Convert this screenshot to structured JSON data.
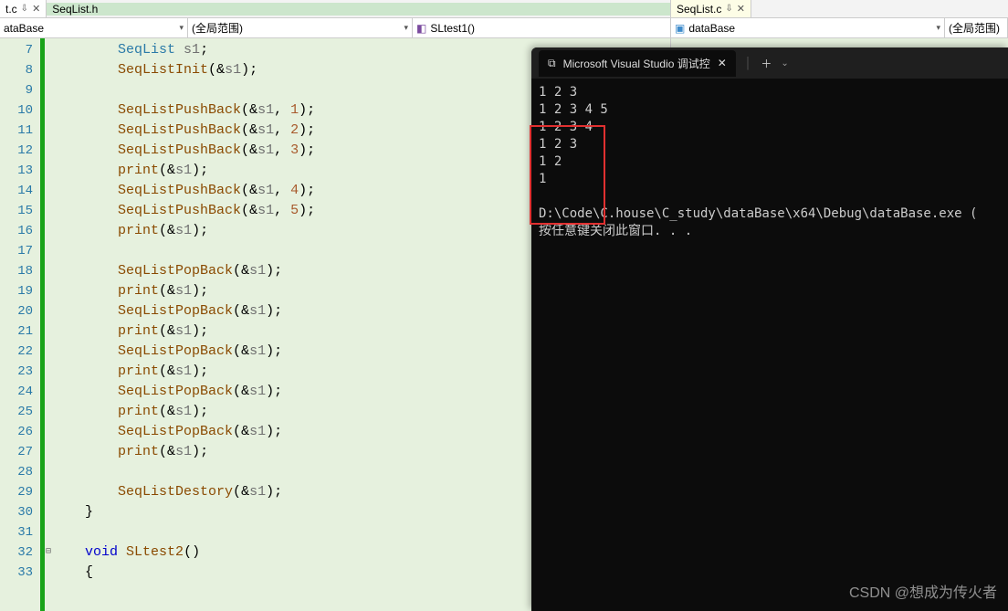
{
  "tabs": {
    "left": {
      "label": "t.c",
      "pin": "⇩",
      "close": "✕"
    },
    "center": {
      "label": "SeqList.h"
    },
    "right_group": {
      "nav_down": "▾",
      "add": "✚"
    },
    "right_pane_tab": {
      "label": "SeqList.c",
      "pin": "⇩",
      "close": "✕"
    }
  },
  "scope": {
    "left1": "ataBase",
    "left2": "(全局范围)",
    "func": "SLtest1()",
    "split": "↔",
    "right1": "dataBase",
    "right2": "(全局范围)"
  },
  "lines": [
    {
      "n": "7",
      "indent": "        ",
      "parts": [
        [
          "type",
          "SeqList"
        ],
        [
          "plain",
          " "
        ],
        [
          "var",
          "s1"
        ],
        [
          "punc",
          ";"
        ]
      ]
    },
    {
      "n": "8",
      "indent": "        ",
      "parts": [
        [
          "func",
          "SeqListInit"
        ],
        [
          "punc",
          "("
        ],
        [
          "op",
          "&"
        ],
        [
          "var",
          "s1"
        ],
        [
          "punc",
          ")"
        ],
        [
          "punc",
          ";"
        ]
      ]
    },
    {
      "n": "9",
      "indent": "",
      "parts": []
    },
    {
      "n": "10",
      "indent": "        ",
      "parts": [
        [
          "func",
          "SeqListPushBack"
        ],
        [
          "punc",
          "("
        ],
        [
          "op",
          "&"
        ],
        [
          "var",
          "s1"
        ],
        [
          "punc",
          ", "
        ],
        [
          "num",
          "1"
        ],
        [
          "punc",
          ")"
        ],
        [
          "punc",
          ";"
        ]
      ]
    },
    {
      "n": "11",
      "indent": "        ",
      "parts": [
        [
          "func",
          "SeqListPushBack"
        ],
        [
          "punc",
          "("
        ],
        [
          "op",
          "&"
        ],
        [
          "var",
          "s1"
        ],
        [
          "punc",
          ", "
        ],
        [
          "num",
          "2"
        ],
        [
          "punc",
          ")"
        ],
        [
          "punc",
          ";"
        ]
      ]
    },
    {
      "n": "12",
      "indent": "        ",
      "parts": [
        [
          "func",
          "SeqListPushBack"
        ],
        [
          "punc",
          "("
        ],
        [
          "op",
          "&"
        ],
        [
          "var",
          "s1"
        ],
        [
          "punc",
          ", "
        ],
        [
          "num",
          "3"
        ],
        [
          "punc",
          ")"
        ],
        [
          "punc",
          ";"
        ]
      ]
    },
    {
      "n": "13",
      "indent": "        ",
      "parts": [
        [
          "func",
          "print"
        ],
        [
          "punc",
          "("
        ],
        [
          "op",
          "&"
        ],
        [
          "var",
          "s1"
        ],
        [
          "punc",
          ")"
        ],
        [
          "punc",
          ";"
        ]
      ]
    },
    {
      "n": "14",
      "indent": "        ",
      "parts": [
        [
          "func",
          "SeqListPushBack"
        ],
        [
          "punc",
          "("
        ],
        [
          "op",
          "&"
        ],
        [
          "var",
          "s1"
        ],
        [
          "punc",
          ", "
        ],
        [
          "num",
          "4"
        ],
        [
          "punc",
          ")"
        ],
        [
          "punc",
          ";"
        ]
      ]
    },
    {
      "n": "15",
      "indent": "        ",
      "parts": [
        [
          "func",
          "SeqListPushBack"
        ],
        [
          "punc",
          "("
        ],
        [
          "op",
          "&"
        ],
        [
          "var",
          "s1"
        ],
        [
          "punc",
          ", "
        ],
        [
          "num",
          "5"
        ],
        [
          "punc",
          ")"
        ],
        [
          "punc",
          ";"
        ]
      ]
    },
    {
      "n": "16",
      "indent": "        ",
      "parts": [
        [
          "func",
          "print"
        ],
        [
          "punc",
          "("
        ],
        [
          "op",
          "&"
        ],
        [
          "var",
          "s1"
        ],
        [
          "punc",
          ")"
        ],
        [
          "punc",
          ";"
        ]
      ]
    },
    {
      "n": "17",
      "indent": "",
      "parts": []
    },
    {
      "n": "18",
      "indent": "        ",
      "parts": [
        [
          "func",
          "SeqListPopBack"
        ],
        [
          "punc",
          "("
        ],
        [
          "op",
          "&"
        ],
        [
          "var",
          "s1"
        ],
        [
          "punc",
          ")"
        ],
        [
          "punc",
          ";"
        ]
      ]
    },
    {
      "n": "19",
      "indent": "        ",
      "parts": [
        [
          "func",
          "print"
        ],
        [
          "punc",
          "("
        ],
        [
          "op",
          "&"
        ],
        [
          "var",
          "s1"
        ],
        [
          "punc",
          ")"
        ],
        [
          "punc",
          ";"
        ]
      ]
    },
    {
      "n": "20",
      "indent": "        ",
      "parts": [
        [
          "func",
          "SeqListPopBack"
        ],
        [
          "punc",
          "("
        ],
        [
          "op",
          "&"
        ],
        [
          "var",
          "s1"
        ],
        [
          "punc",
          ")"
        ],
        [
          "punc",
          ";"
        ]
      ]
    },
    {
      "n": "21",
      "indent": "        ",
      "parts": [
        [
          "func",
          "print"
        ],
        [
          "punc",
          "("
        ],
        [
          "op",
          "&"
        ],
        [
          "var",
          "s1"
        ],
        [
          "punc",
          ")"
        ],
        [
          "punc",
          ";"
        ]
      ]
    },
    {
      "n": "22",
      "indent": "        ",
      "parts": [
        [
          "func",
          "SeqListPopBack"
        ],
        [
          "punc",
          "("
        ],
        [
          "op",
          "&"
        ],
        [
          "var",
          "s1"
        ],
        [
          "punc",
          ")"
        ],
        [
          "punc",
          ";"
        ]
      ]
    },
    {
      "n": "23",
      "indent": "        ",
      "parts": [
        [
          "func",
          "print"
        ],
        [
          "punc",
          "("
        ],
        [
          "op",
          "&"
        ],
        [
          "var",
          "s1"
        ],
        [
          "punc",
          ")"
        ],
        [
          "punc",
          ";"
        ]
      ]
    },
    {
      "n": "24",
      "indent": "        ",
      "parts": [
        [
          "func",
          "SeqListPopBack"
        ],
        [
          "punc",
          "("
        ],
        [
          "op",
          "&"
        ],
        [
          "var",
          "s1"
        ],
        [
          "punc",
          ")"
        ],
        [
          "punc",
          ";"
        ]
      ]
    },
    {
      "n": "25",
      "indent": "        ",
      "parts": [
        [
          "func",
          "print"
        ],
        [
          "punc",
          "("
        ],
        [
          "op",
          "&"
        ],
        [
          "var",
          "s1"
        ],
        [
          "punc",
          ")"
        ],
        [
          "punc",
          ";"
        ]
      ]
    },
    {
      "n": "26",
      "indent": "        ",
      "parts": [
        [
          "func",
          "SeqListPopBack"
        ],
        [
          "punc",
          "("
        ],
        [
          "op",
          "&"
        ],
        [
          "var",
          "s1"
        ],
        [
          "punc",
          ")"
        ],
        [
          "punc",
          ";"
        ]
      ]
    },
    {
      "n": "27",
      "indent": "        ",
      "parts": [
        [
          "func",
          "print"
        ],
        [
          "punc",
          "("
        ],
        [
          "op",
          "&"
        ],
        [
          "var",
          "s1"
        ],
        [
          "punc",
          ")"
        ],
        [
          "punc",
          ";"
        ]
      ]
    },
    {
      "n": "28",
      "indent": "",
      "parts": []
    },
    {
      "n": "29",
      "indent": "        ",
      "parts": [
        [
          "func",
          "SeqListDestory"
        ],
        [
          "punc",
          "("
        ],
        [
          "op",
          "&"
        ],
        [
          "var",
          "s1"
        ],
        [
          "punc",
          ")"
        ],
        [
          "punc",
          ";"
        ]
      ]
    },
    {
      "n": "30",
      "indent": "    ",
      "parts": [
        [
          "punc",
          "}"
        ]
      ]
    },
    {
      "n": "31",
      "indent": "",
      "parts": []
    },
    {
      "n": "32",
      "indent": "    ",
      "fold": "⊟",
      "parts": [
        [
          "kw",
          "void"
        ],
        [
          "plain",
          " "
        ],
        [
          "func",
          "SLtest2"
        ],
        [
          "punc",
          "()"
        ]
      ]
    },
    {
      "n": "33",
      "indent": "    ",
      "parts": [
        [
          "punc",
          "{"
        ]
      ]
    }
  ],
  "terminal": {
    "title": "Microsoft Visual Studio 调试控",
    "close": "✕",
    "add": "＋",
    "chev": "⌄",
    "out": [
      "1 2 3",
      "1 2 3 4 5",
      "1 2 3 4",
      "1 2 3",
      "1 2",
      "1",
      "",
      "D:\\Code\\C.house\\C_study\\dataBase\\x64\\Debug\\dataBase.exe (",
      "按任意键关闭此窗口. . ."
    ]
  },
  "watermark": "CSDN @想成为传火者"
}
